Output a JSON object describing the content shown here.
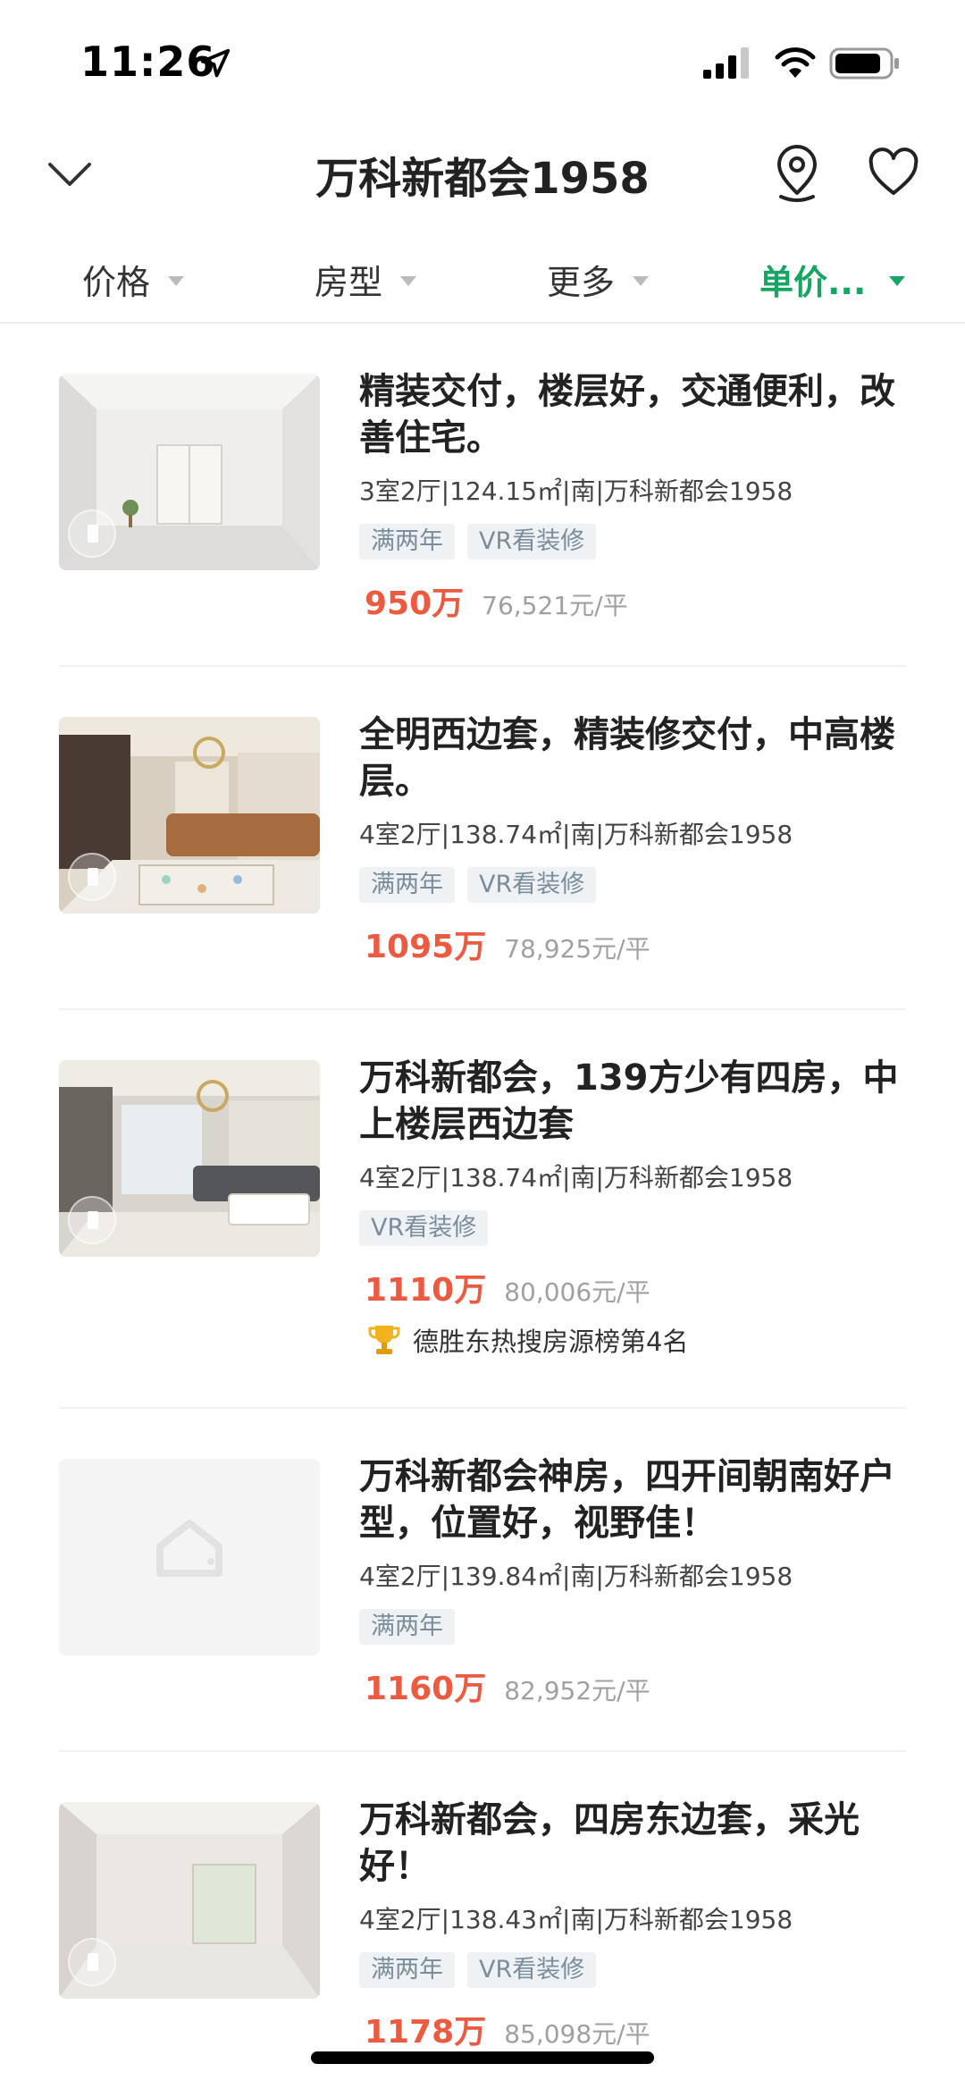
{
  "status_bar": {
    "time": "11:26"
  },
  "nav": {
    "title": "万科新都会1958"
  },
  "filters": [
    {
      "label": "价格",
      "active": false
    },
    {
      "label": "房型",
      "active": false
    },
    {
      "label": "更多",
      "active": false
    },
    {
      "label": "单价...",
      "active": true
    }
  ],
  "colors": {
    "accent": "#17a563",
    "price": "#ec5a3f",
    "tag_bg": "#eef2f5",
    "tag_text": "#7b8c9a"
  },
  "listings": [
    {
      "title": "精装交付，楼层好，交通便利，改善住宅。",
      "meta": "3室2厅|124.15㎡|南|万科新都会1958",
      "tags": [
        "满两年",
        "VR看装修"
      ],
      "price": "950万",
      "unit_price": "76,521元/平",
      "has_vr": true
    },
    {
      "title": "全明西边套，精装修交付，中高楼层。",
      "meta": "4室2厅|138.74㎡|南|万科新都会1958",
      "tags": [
        "满两年",
        "VR看装修"
      ],
      "price": "1095万",
      "unit_price": "78,925元/平",
      "has_vr": true
    },
    {
      "title": "万科新都会，139方少有四房，中上楼层西边套",
      "meta": "4室2厅|138.74㎡|南|万科新都会1958",
      "tags": [
        "VR看装修"
      ],
      "price": "1110万",
      "unit_price": "80,006元/平",
      "rank": "德胜东热搜房源榜第4名",
      "has_vr": true
    },
    {
      "title": "万科新都会神房，四开间朝南好户型，位置好，视野佳！",
      "meta": "4室2厅|139.84㎡|南|万科新都会1958",
      "tags": [
        "满两年"
      ],
      "price": "1160万",
      "unit_price": "82,952元/平",
      "has_vr": false
    },
    {
      "title": "万科新都会，四房东边套，采光好！",
      "meta": "4室2厅|138.43㎡|南|万科新都会1958",
      "tags": [
        "满两年",
        "VR看装修"
      ],
      "price": "1178万",
      "unit_price": "85,098元/平",
      "has_vr": true
    }
  ]
}
